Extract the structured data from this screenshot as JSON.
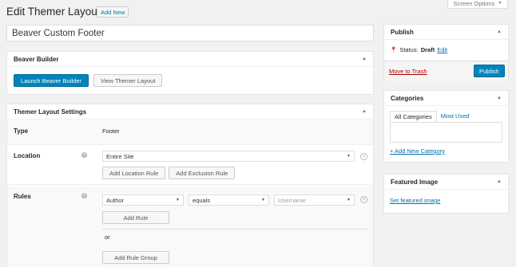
{
  "header": {
    "screen_options": "Screen Options",
    "title": "Edit Themer Layout",
    "add_new": "Add New"
  },
  "post_title": "Beaver Custom Footer",
  "beaver_builder": {
    "title": "Beaver Builder",
    "launch": "Launch Beaver Builder",
    "view": "View Themer Layout"
  },
  "settings": {
    "title": "Themer Layout Settings",
    "type_label": "Type",
    "type_value": "Footer",
    "location_label": "Location",
    "location_value": "Entire Site",
    "add_location_rule": "Add Location Rule",
    "add_exclusion_rule": "Add Exclusion Rule",
    "rules_label": "Rules",
    "rule_field": "Author",
    "rule_operator": "equals",
    "rule_value_placeholder": "Username",
    "add_rule": "Add Rule",
    "or": "or",
    "add_rule_group": "Add Rule Group"
  },
  "publish": {
    "title": "Publish",
    "status_label": "Status:",
    "status_value": "Draft",
    "edit": "Edit",
    "trash": "Move to Trash",
    "publish_button": "Publish"
  },
  "categories": {
    "title": "Categories",
    "tab_all": "All Categories",
    "tab_used": "Most Used",
    "add_new": "+ Add New Category"
  },
  "featured": {
    "title": "Featured Image",
    "set": "Set featured image"
  }
}
